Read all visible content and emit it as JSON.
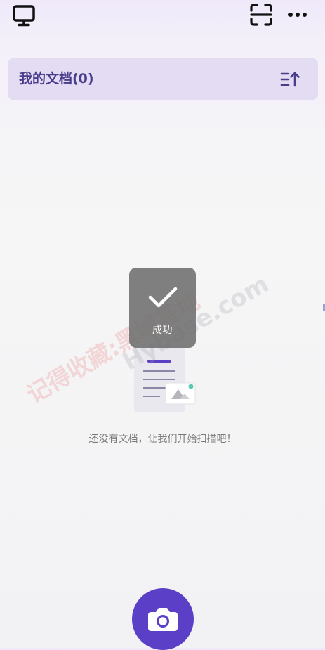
{
  "header": {
    "title": "我的文档(0)"
  },
  "toast": {
    "text": "成功"
  },
  "empty_state": {
    "message": "还没有文档，让我们开始扫描吧！"
  },
  "watermark": {
    "cn": "记得收藏:黑域基地",
    "en": "Hybase.com"
  },
  "icons": {
    "top_left": "monitor-icon",
    "top_right_1": "scan-icon",
    "top_right_2": "more-icon",
    "sort": "sort-icon",
    "camera": "camera-icon",
    "toast": "check-icon"
  },
  "colors": {
    "accent": "#5b3fc7",
    "header_bg": "#e3dcf3",
    "header_text": "#4a3d8c"
  }
}
